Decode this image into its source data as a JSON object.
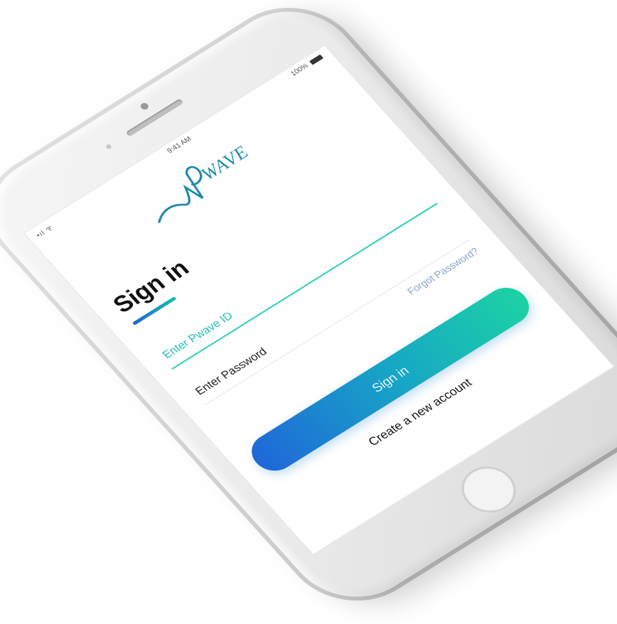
{
  "status_bar": {
    "time": "9:41 AM",
    "signal": "•ıl ᯤ",
    "battery": "100%"
  },
  "logo": {
    "text": "WAVE"
  },
  "signin": {
    "title": "Sign in",
    "id_placeholder": "Enter Pwave ID",
    "password_placeholder": "Enter Password",
    "forgot_label": "Forgot Password?",
    "button_label": "Sign in",
    "create_account_label": "Create a new account"
  },
  "colors": {
    "accent": "#20c4b0",
    "button_start": "#1f67d9",
    "button_end": "#1cd2a4",
    "logo": "#1e8aa8"
  }
}
